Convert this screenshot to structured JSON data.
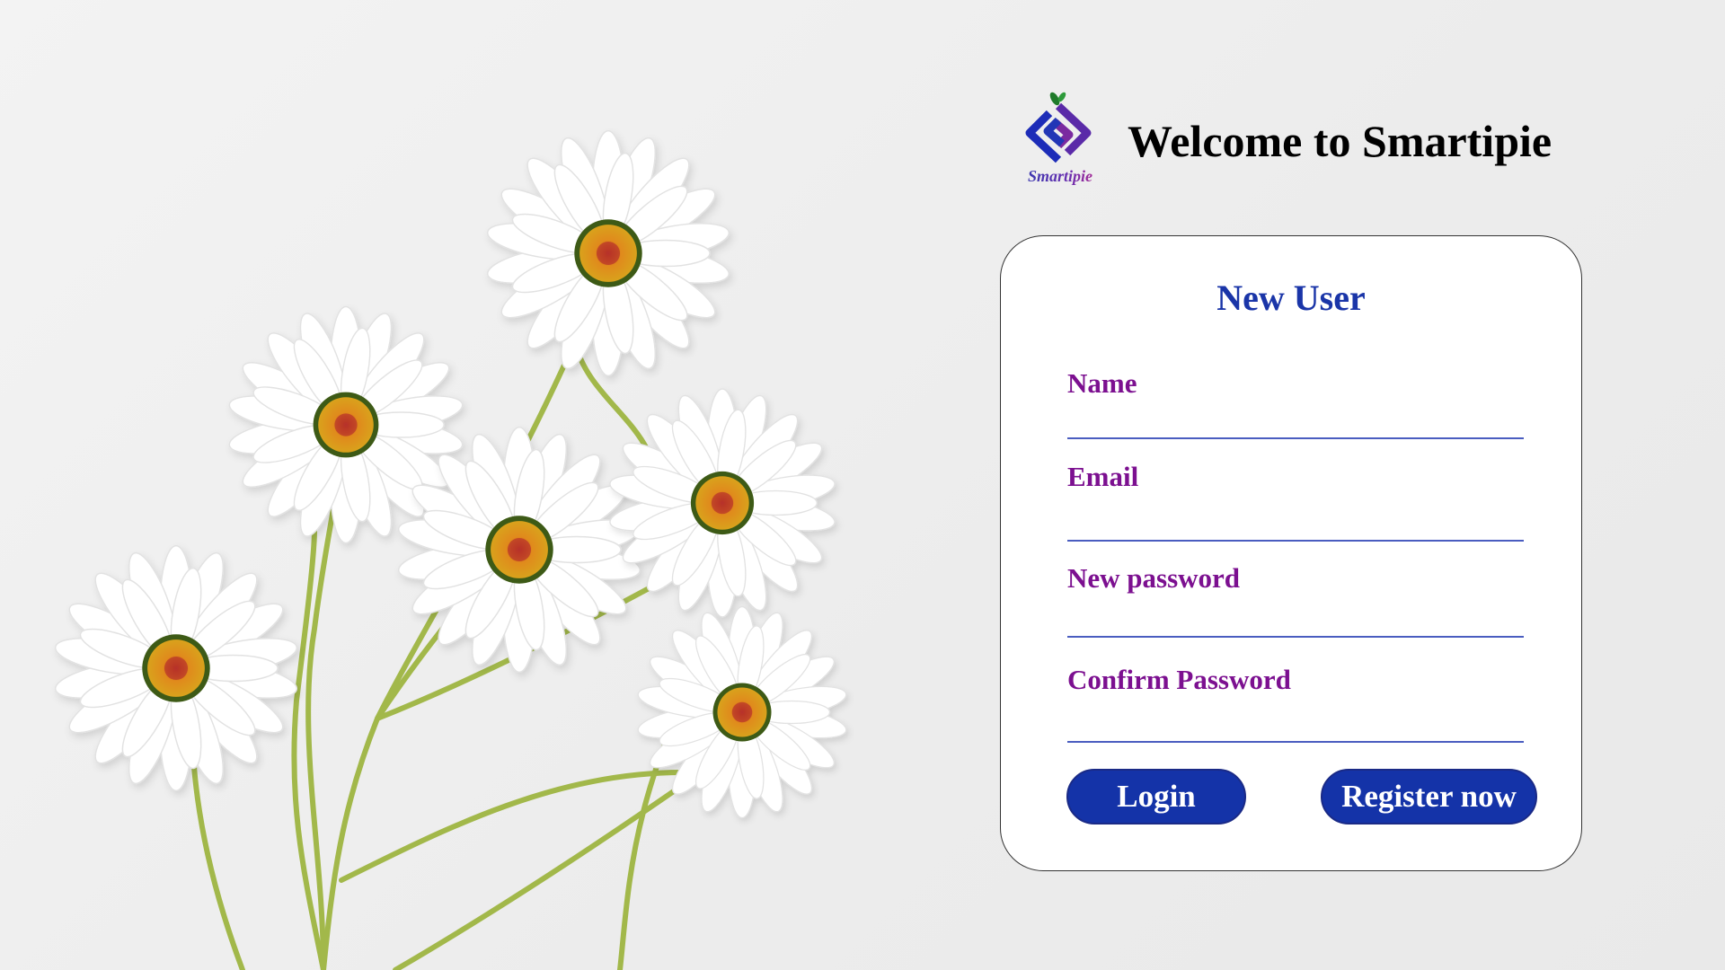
{
  "header": {
    "title": "Welcome to Smartipie",
    "logo_text": "Smartipie",
    "logo_icon": "smartipie-logo-icon"
  },
  "form": {
    "title": "New User",
    "fields": [
      {
        "label": "Name",
        "value": "",
        "placeholder": ""
      },
      {
        "label": "Email",
        "value": "",
        "placeholder": ""
      },
      {
        "label": "New password",
        "value": "",
        "placeholder": ""
      },
      {
        "label": "Confirm Password",
        "value": "",
        "placeholder": ""
      }
    ],
    "login_label": "Login",
    "register_label": "Register now"
  },
  "colors": {
    "accent_blue": "#1433a8",
    "title_blue": "#1a35a8",
    "label_purple": "#7c1090",
    "underline": "#4a5dc0",
    "background": "#efefef"
  },
  "image": {
    "subject": "daisy-bouquet-illustration"
  }
}
